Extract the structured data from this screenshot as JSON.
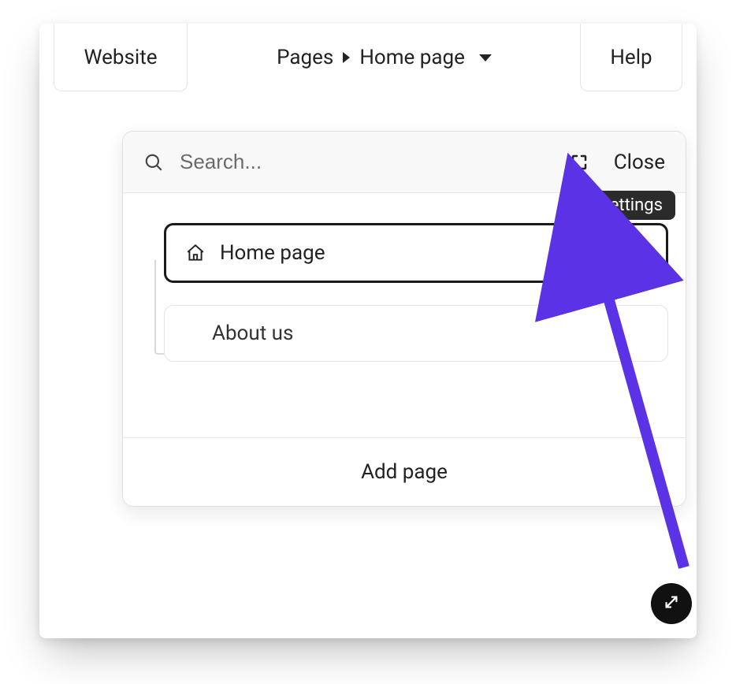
{
  "topbar": {
    "website_label": "Website",
    "pages_label": "Pages",
    "current_page": "Home page",
    "help_label": "Help"
  },
  "panel": {
    "search_placeholder": "Search...",
    "close_label": "Close",
    "settings_tooltip": "Settings",
    "add_page_label": "Add page",
    "pages": [
      {
        "label": "Home page",
        "is_home": true,
        "active": true
      },
      {
        "label": "About us",
        "is_home": false,
        "active": false
      }
    ]
  }
}
